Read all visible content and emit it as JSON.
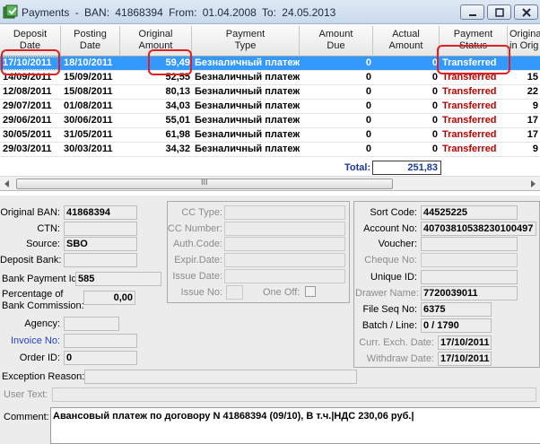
{
  "window": {
    "title": "Payments - BAN: 41868394   From: 01.04.2008   To: 24.05.2013"
  },
  "grid": {
    "columns": [
      "Deposit\nDate",
      "Posting\nDate",
      "Original\nAmount",
      "Payment\nType",
      "Amount\nDue",
      "Actual\nAmount",
      "Payment\nStatus",
      "Original\nin Orig"
    ],
    "rows": [
      {
        "deposit": "17/10/2011",
        "posting": "18/10/2011",
        "amount": "59,49",
        "type": "Безналичный платеж",
        "due": "0",
        "actual": "0",
        "status": "Transferred",
        "orig": "",
        "selected": true
      },
      {
        "deposit": "14/09/2011",
        "posting": "15/09/2011",
        "amount": "52,55",
        "type": "Безналичный платеж",
        "due": "0",
        "actual": "0",
        "status": "Transferred",
        "orig": "15"
      },
      {
        "deposit": "12/08/2011",
        "posting": "15/08/2011",
        "amount": "80,13",
        "type": "Безналичный платеж",
        "due": "0",
        "actual": "0",
        "status": "Transferred",
        "orig": "22"
      },
      {
        "deposit": "29/07/2011",
        "posting": "01/08/2011",
        "amount": "34,03",
        "type": "Безналичный платеж",
        "due": "0",
        "actual": "0",
        "status": "Transferred",
        "orig": "9"
      },
      {
        "deposit": "29/06/2011",
        "posting": "30/06/2011",
        "amount": "55,01",
        "type": "Безналичный платеж",
        "due": "0",
        "actual": "0",
        "status": "Transferred",
        "orig": "17"
      },
      {
        "deposit": "30/05/2011",
        "posting": "31/05/2011",
        "amount": "61,98",
        "type": "Безналичный платеж",
        "due": "0",
        "actual": "0",
        "status": "Transferred",
        "orig": "17"
      },
      {
        "deposit": "29/03/2011",
        "posting": "30/03/2011",
        "amount": "34,32",
        "type": "Безналичный платеж",
        "due": "0",
        "actual": "0",
        "status": "Transferred",
        "orig": "9"
      }
    ],
    "total_label": "Total:",
    "total_value": "251,83",
    "scroll_grip": "III"
  },
  "detail": {
    "original_ban": {
      "label": "Original BAN:",
      "value": "41868394"
    },
    "ctn": {
      "label": "CTN:",
      "value": ""
    },
    "source": {
      "label": "Source:",
      "value": "SBO"
    },
    "deposit_bank": {
      "label": "Deposit Bank:",
      "value": ""
    },
    "bank_payment_id": {
      "label": "Bank Payment Id:",
      "value": "585"
    },
    "percentage": {
      "label1": "Percentage of",
      "label2": "Bank Commission:",
      "value": "0,00"
    },
    "agency": {
      "label": "Agency:",
      "value": ""
    },
    "invoice_no": {
      "label": "Invoice No:",
      "value": ""
    },
    "order_id": {
      "label": "Order ID:",
      "value": "0"
    },
    "cc_type": {
      "label": "CC Type:",
      "value": ""
    },
    "cc_number": {
      "label": "CC Number:",
      "value": ""
    },
    "auth_code": {
      "label": "Auth.Code:",
      "value": ""
    },
    "expir_date": {
      "label": "Expir.Date:",
      "value": ""
    },
    "issue_date": {
      "label": "Issue Date:",
      "value": ""
    },
    "issue_no": {
      "label": "Issue No:",
      "value": ""
    },
    "one_off": {
      "label": "One Off:"
    },
    "sort_code": {
      "label": "Sort Code:",
      "value": "44525225"
    },
    "account_no": {
      "label": "Account No:",
      "value": "40703810538230100497"
    },
    "voucher": {
      "label": "Voucher:",
      "value": ""
    },
    "cheque_no": {
      "label": "Cheque No:",
      "value": ""
    },
    "unique_id": {
      "label": "Unique ID:",
      "value": ""
    },
    "drawer_name": {
      "label": "Drawer Name:",
      "value": "7720039011"
    },
    "file_seq_no": {
      "label": "File Seq No:",
      "value": "6375"
    },
    "batch_line": {
      "label": "Batch / Line:",
      "value": "0 / 1790"
    },
    "curr_exch_date": {
      "label": "Curr. Exch. Date:",
      "value": "17/10/2011"
    },
    "withdraw_date": {
      "label": "Withdraw Date:",
      "value": "17/10/2011"
    },
    "exception_reason": {
      "label": "Exception Reason:",
      "value": ""
    },
    "user_text": {
      "label": "User Text:",
      "value": ""
    },
    "comment": {
      "label": "Comment:",
      "value": "Авансовый платеж по договору N 41868394 (09/10), В т.ч.|НДС 230,06 руб.|"
    }
  },
  "colors": {
    "selection": "#3399ff",
    "status_text": "#c00000",
    "annotation": "#e02020",
    "link": "#1c3fd0"
  },
  "icons": [
    "app-icon",
    "minimize-icon",
    "maximize-icon",
    "close-icon",
    "scroll-left-icon",
    "scroll-right-icon"
  ]
}
